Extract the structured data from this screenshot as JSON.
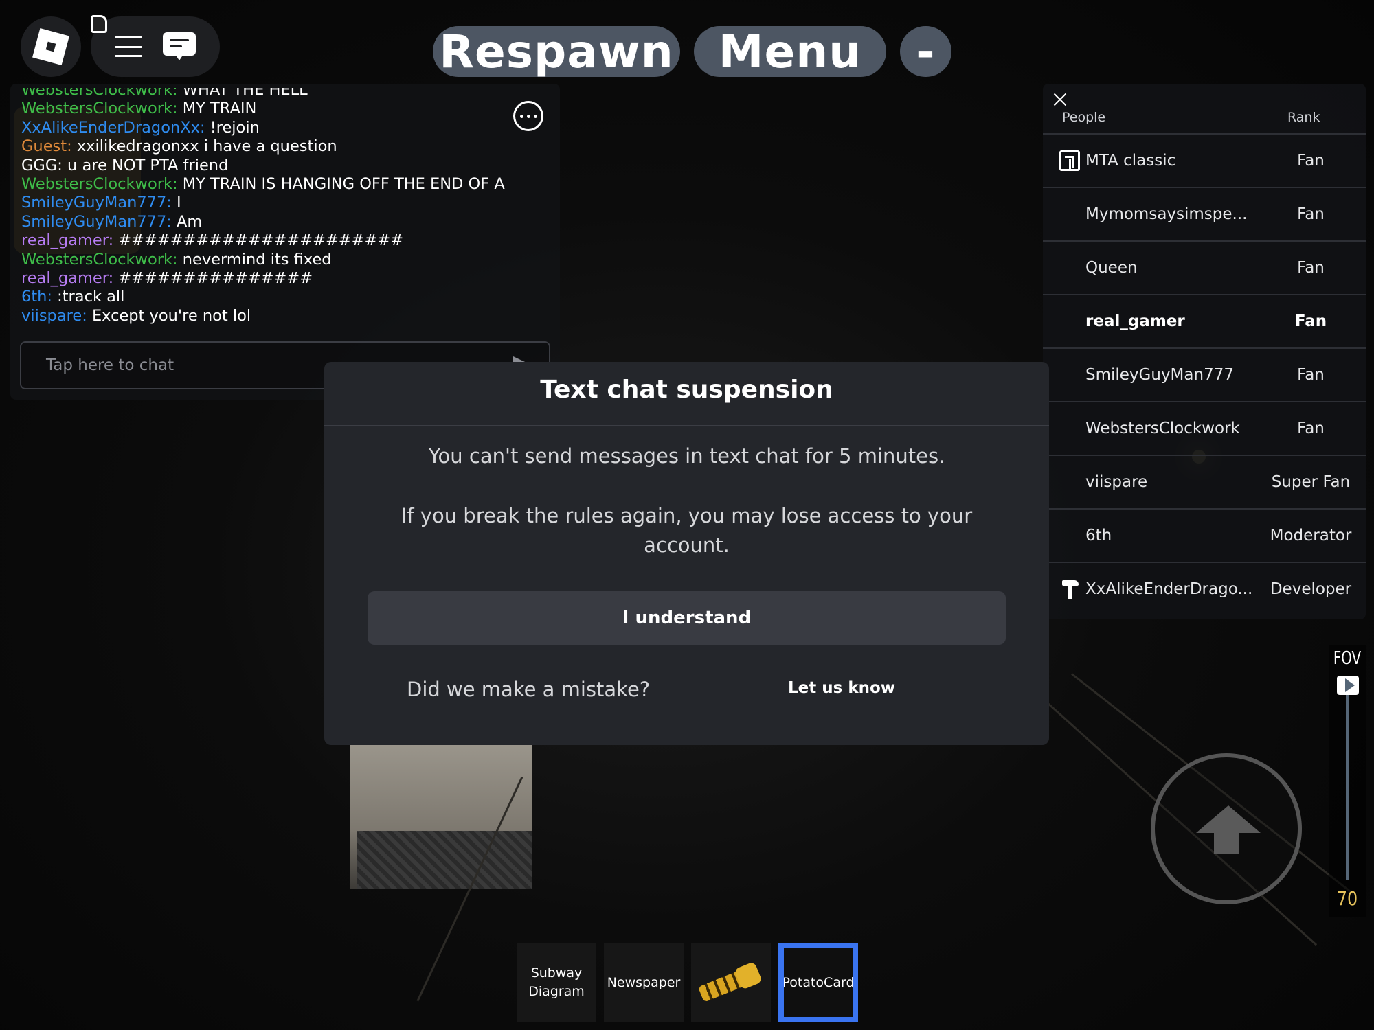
{
  "topbar": {
    "respawn_label": "Respawn",
    "menu_label": "Menu",
    "minimize_label": "-"
  },
  "chat": {
    "messages": [
      {
        "name": "WebstersClockwork:",
        "text": "WHAT THE HELL",
        "color": "#3fbf4a"
      },
      {
        "name": "WebstersClockwork:",
        "text": "MY TRAIN",
        "color": "#3fbf4a"
      },
      {
        "name": "XxAlikeEnderDragonXx:",
        "text": "!rejoin",
        "color": "#2f8cf0"
      },
      {
        "name": "Guest:",
        "text": "xxilikedragonxx i have a question",
        "color": "#e08a3a"
      },
      {
        "name": "GGG:",
        "text": "u are NOT PTA friend",
        "color": "#ffffff"
      },
      {
        "name": "WebstersClockwork:",
        "text": "MY TRAIN IS HANGING OFF THE END OF A",
        "color": "#3fbf4a"
      },
      {
        "name": "SmileyGuyMan777:",
        "text": "I",
        "color": "#2f8cf0"
      },
      {
        "name": "SmileyGuyMan777:",
        "text": "Am",
        "color": "#2f8cf0"
      },
      {
        "name": "real_gamer:",
        "text": "######################",
        "color": "#b67cf2"
      },
      {
        "name": "WebstersClockwork:",
        "text": "nevermind its fixed",
        "color": "#3fbf4a"
      },
      {
        "name": "real_gamer:",
        "text": "###############",
        "color": "#b67cf2"
      },
      {
        "name": "6th:",
        "text": ":track all",
        "color": "#2f8cf0"
      },
      {
        "name": "viispare:",
        "text": "Except you're not lol",
        "color": "#2f8cf0"
      }
    ],
    "input_placeholder": "Tap here to chat"
  },
  "player_list": {
    "header_people": "People",
    "header_rank": "Rank",
    "players": [
      {
        "name": "MTA classic",
        "rank": "Fan",
        "icon": "mta-logo-icon"
      },
      {
        "name": "Mymomsaysimspe...",
        "rank": "Fan",
        "icon": ""
      },
      {
        "name": "Queen",
        "rank": "Fan",
        "icon": ""
      },
      {
        "name": "real_gamer",
        "rank": "Fan",
        "icon": "",
        "is_self": true
      },
      {
        "name": "SmileyGuyMan777",
        "rank": "Fan",
        "icon": ""
      },
      {
        "name": "WebstersClockwork",
        "rank": "Fan",
        "icon": ""
      },
      {
        "name": "viispare",
        "rank": "Super Fan",
        "icon": ""
      },
      {
        "name": "6th",
        "rank": "Moderator",
        "icon": ""
      },
      {
        "name": "XxAlikeEnderDrago...",
        "rank": "Developer",
        "icon": "hammer-icon"
      }
    ]
  },
  "modal": {
    "title": "Text chat suspension",
    "message1": "You can't send messages in text chat for 5 minutes.",
    "message2": "If you break the rules again, you may lose access to your account.",
    "button_label": "I understand",
    "mistake_text": "Did we make a mistake?",
    "link_label": "Let us know"
  },
  "fov": {
    "label": "FOV",
    "value": "70"
  },
  "hotbar": {
    "slots": [
      {
        "label": "Subway Diagram"
      },
      {
        "label": "Newspaper"
      },
      {
        "label": "",
        "icon": "flashlight-icon"
      },
      {
        "label": "PotatoCard",
        "selected": true
      }
    ]
  },
  "colors": {
    "modal_bg": "#24262b",
    "selected_slot": "#3a74f0",
    "fov_value": "#e8c45c"
  }
}
